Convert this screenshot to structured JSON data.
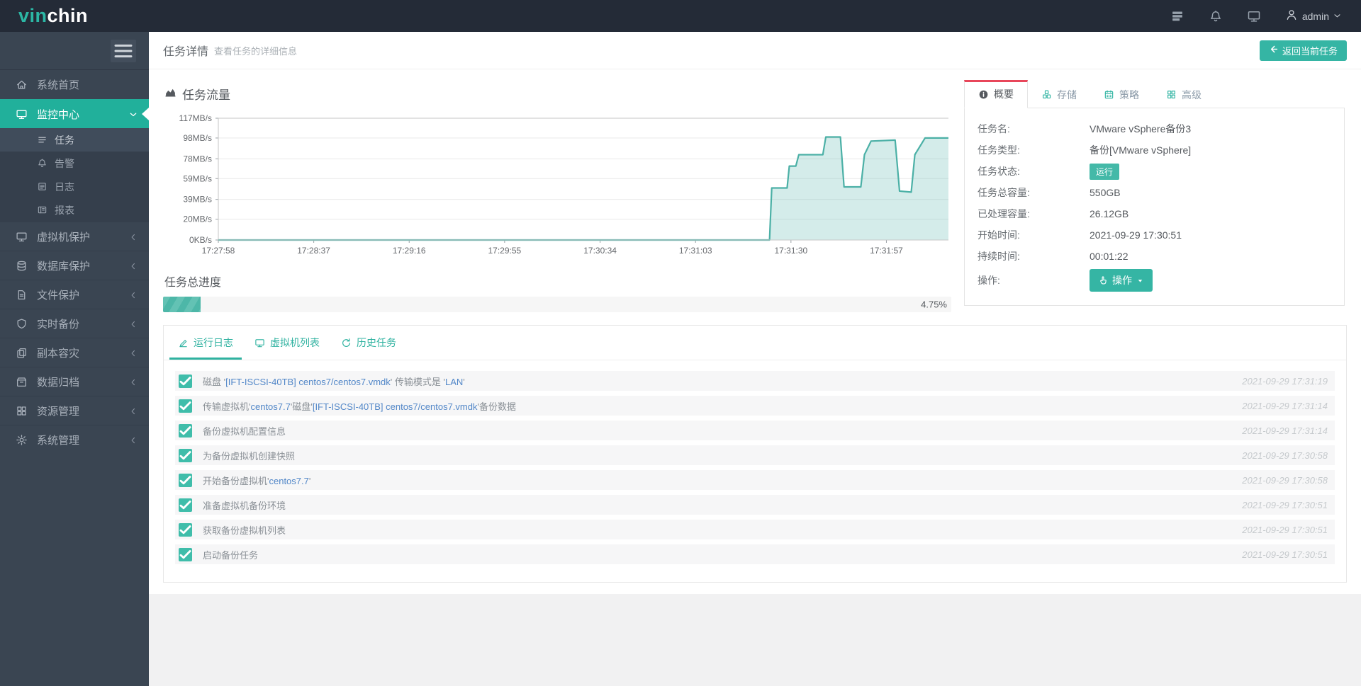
{
  "topbar": {
    "logo_prefix": "vin",
    "logo_suffix": "chin",
    "user": "admin",
    "icons": [
      "server-stack-icon",
      "bell-icon",
      "monitor-icon",
      "user-icon"
    ]
  },
  "sidebar": {
    "items": [
      {
        "label": "系统首页",
        "icon": "home",
        "state": "plain"
      },
      {
        "label": "监控中心",
        "icon": "display",
        "state": "active"
      },
      {
        "label": "虚拟机保护",
        "icon": "display",
        "state": "collapsed"
      },
      {
        "label": "数据库保护",
        "icon": "db",
        "state": "collapsed"
      },
      {
        "label": "文件保护",
        "icon": "file",
        "state": "collapsed"
      },
      {
        "label": "实时备份",
        "icon": "shield",
        "state": "collapsed"
      },
      {
        "label": "副本容灾",
        "icon": "copy",
        "state": "collapsed"
      },
      {
        "label": "数据归档",
        "icon": "box",
        "state": "collapsed"
      },
      {
        "label": "资源管理",
        "icon": "grid",
        "state": "collapsed"
      },
      {
        "label": "系统管理",
        "icon": "gear",
        "state": "collapsed"
      }
    ],
    "submenu": [
      {
        "label": "任务",
        "icon": "list",
        "active": true
      },
      {
        "label": "告警",
        "icon": "bell",
        "active": false
      },
      {
        "label": "日志",
        "icon": "doc",
        "active": false
      },
      {
        "label": "报表",
        "icon": "report",
        "active": false
      }
    ]
  },
  "header": {
    "title": "任务详情",
    "subtitle": "查看任务的详细信息",
    "back_button": "返回当前任务"
  },
  "traffic": {
    "title": "任务流量"
  },
  "chart_data": {
    "type": "area",
    "title": "任务流量",
    "unit": "MB/s",
    "ylim": [
      0,
      117
    ],
    "grid": true,
    "y_ticks": [
      {
        "v": 0,
        "label": "0KB/s"
      },
      {
        "v": 20,
        "label": "20MB/s"
      },
      {
        "v": 39,
        "label": "39MB/s"
      },
      {
        "v": 59,
        "label": "59MB/s"
      },
      {
        "v": 78,
        "label": "78MB/s"
      },
      {
        "v": 98,
        "label": "98MB/s"
      },
      {
        "v": 117,
        "label": "117MB/s"
      }
    ],
    "x_ticks": [
      "17:27:58",
      "17:28:37",
      "17:29:16",
      "17:29:55",
      "17:30:34",
      "17:31:03",
      "17:31:30",
      "17:31:57"
    ],
    "x_tick_fractions": [
      0,
      0.1307,
      0.2614,
      0.3921,
      0.5229,
      0.6536,
      0.7843,
      0.915
    ],
    "series": [
      {
        "name": "任务流量",
        "points": [
          [
            0,
            0
          ],
          [
            0.755,
            0
          ],
          [
            0.758,
            50
          ],
          [
            0.779,
            50
          ],
          [
            0.782,
            71
          ],
          [
            0.791,
            71
          ],
          [
            0.795,
            82
          ],
          [
            0.828,
            82
          ],
          [
            0.832,
            99
          ],
          [
            0.852,
            99
          ],
          [
            0.857,
            51
          ],
          [
            0.88,
            51
          ],
          [
            0.885,
            82
          ],
          [
            0.894,
            95
          ],
          [
            0.927,
            96
          ],
          [
            0.933,
            47
          ],
          [
            0.949,
            46
          ],
          [
            0.954,
            82
          ],
          [
            0.968,
            98
          ],
          [
            1,
            98
          ]
        ]
      }
    ]
  },
  "progress": {
    "title": "任务总进度",
    "percent_label": "4.75%",
    "percent_value": 4.75
  },
  "overview": {
    "tabs": [
      {
        "label": "概要",
        "icon": "info",
        "active": true
      },
      {
        "label": "存储",
        "icon": "storage",
        "active": false
      },
      {
        "label": "策略",
        "icon": "calendar",
        "active": false
      },
      {
        "label": "高级",
        "icon": "grid",
        "active": false
      }
    ],
    "fields": [
      {
        "label": "任务名:",
        "value": "VMware vSphere备份3",
        "type": "text"
      },
      {
        "label": "任务类型:",
        "value": "备份[VMware vSphere]",
        "type": "text"
      },
      {
        "label": "任务状态:",
        "value": "运行",
        "type": "badge"
      },
      {
        "label": "任务总容量:",
        "value": "550GB",
        "type": "text"
      },
      {
        "label": "已处理容量:",
        "value": "26.12GB",
        "type": "text"
      },
      {
        "label": "开始时间:",
        "value": "2021-09-29 17:30:51",
        "type": "text"
      },
      {
        "label": "持续时间:",
        "value": "00:01:22",
        "type": "text"
      },
      {
        "label": "操作:",
        "value": "操作",
        "type": "button"
      }
    ]
  },
  "logs": {
    "tabs": [
      {
        "label": "运行日志",
        "icon": "edit",
        "active": true
      },
      {
        "label": "虚拟机列表",
        "icon": "display",
        "active": false
      },
      {
        "label": "历史任务",
        "icon": "history",
        "active": false
      }
    ],
    "rows": [
      {
        "parts": [
          {
            "t": "磁盘 '"
          },
          {
            "t": "[IFT-ISCSI-40TB] centos7/centos7.vmdk",
            "link": true
          },
          {
            "t": "' 传输模式是 '"
          },
          {
            "t": "LAN",
            "link": true
          },
          {
            "t": "'"
          }
        ],
        "time": "2021-09-29 17:31:19"
      },
      {
        "parts": [
          {
            "t": "传输虚拟机'"
          },
          {
            "t": "centos7.7",
            "link": true
          },
          {
            "t": "'磁盘'"
          },
          {
            "t": "[IFT-ISCSI-40TB] centos7/centos7.vmdk",
            "link": true
          },
          {
            "t": "'备份数据"
          }
        ],
        "time": "2021-09-29 17:31:14"
      },
      {
        "parts": [
          {
            "t": "备份虚拟机配置信息"
          }
        ],
        "time": "2021-09-29 17:31:14"
      },
      {
        "parts": [
          {
            "t": "为备份虚拟机创建快照"
          }
        ],
        "time": "2021-09-29 17:30:58"
      },
      {
        "parts": [
          {
            "t": "开始备份虚拟机'"
          },
          {
            "t": "centos7.7",
            "link": true
          },
          {
            "t": "'"
          }
        ],
        "time": "2021-09-29 17:30:58"
      },
      {
        "parts": [
          {
            "t": "准备虚拟机备份环境"
          }
        ],
        "time": "2021-09-29 17:30:51"
      },
      {
        "parts": [
          {
            "t": "获取备份虚拟机列表"
          }
        ],
        "time": "2021-09-29 17:30:51"
      },
      {
        "parts": [
          {
            "t": "启动备份任务"
          }
        ],
        "time": "2021-09-29 17:30:51"
      }
    ]
  },
  "colors": {
    "accent_teal": "#21b09b",
    "tab_active_marker": "#e8465a",
    "link_blue": "#5287c8",
    "chart_line": "#4bb0a6",
    "chart_fill": "rgba(102,187,178,0.28)",
    "topbar_bg": "#242b37",
    "sidebar_bg": "#3a4552"
  }
}
